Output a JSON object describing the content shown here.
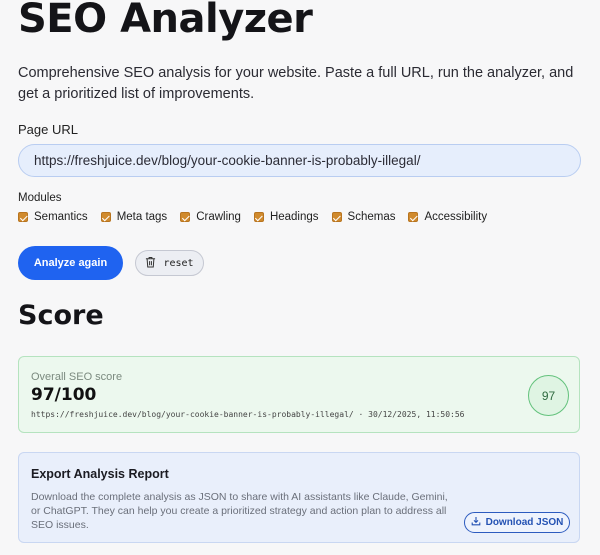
{
  "header": {
    "title": "SEO Analyzer",
    "intro": "Comprehensive SEO analysis for your website. Paste a full URL, run the analyzer, and get a prioritized list of improvements."
  },
  "form": {
    "url_label": "Page URL",
    "url_value": "https://freshjuice.dev/blog/your-cookie-banner-is-probably-illegal/",
    "modules_label": "Modules",
    "modules": [
      {
        "label": "Semantics",
        "checked": true
      },
      {
        "label": "Meta tags",
        "checked": true
      },
      {
        "label": "Crawling",
        "checked": true
      },
      {
        "label": "Headings",
        "checked": true
      },
      {
        "label": "Schemas",
        "checked": true
      },
      {
        "label": "Accessibility",
        "checked": true
      }
    ],
    "checkbox_color": "#d08a2d",
    "analyze_label": "Analyze again",
    "analyze_color": "#1f63f0",
    "reset_label": "reset",
    "reset_icon": "trash-icon"
  },
  "score": {
    "heading": "Score",
    "card_label": "Overall SEO score",
    "value": "97/100",
    "meta": "https://freshjuice.dev/blog/your-cookie-banner-is-probably-illegal/ · 30/12/2025, 11:50:56",
    "badge": "97",
    "badge_color": "#63c27c"
  },
  "export": {
    "title": "Export Analysis Report",
    "description": "Download the complete analysis as JSON to share with AI assistants like Claude, Gemini, or ChatGPT. They can help you create a prioritized strategy and action plan to address all SEO issues.",
    "download_label": "Download JSON",
    "download_icon": "download-icon"
  }
}
